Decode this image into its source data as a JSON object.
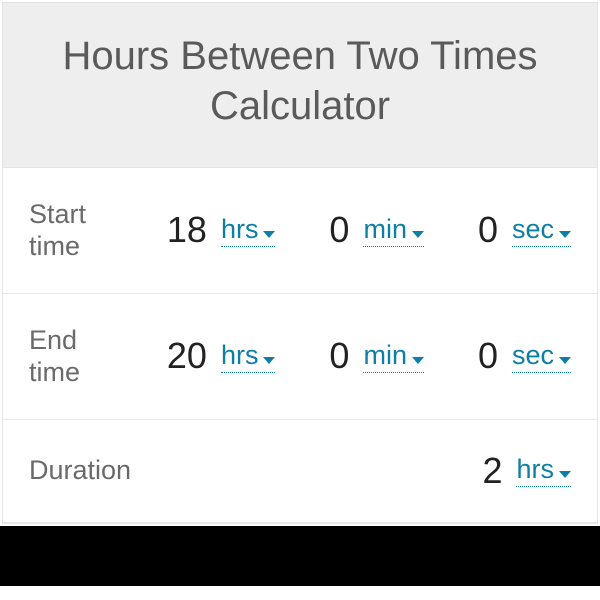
{
  "title": "Hours Between Two Times Calculator",
  "rows": {
    "start": {
      "label": "Start time",
      "hrs_val": "18",
      "hrs_unit": "hrs",
      "min_val": "0",
      "min_unit": "min",
      "sec_val": "0",
      "sec_unit": "sec"
    },
    "end": {
      "label": "End time",
      "hrs_val": "20",
      "hrs_unit": "hrs",
      "min_val": "0",
      "min_unit": "min",
      "sec_val": "0",
      "sec_unit": "sec"
    },
    "duration": {
      "label": "Duration",
      "val": "2",
      "unit": "hrs"
    }
  }
}
